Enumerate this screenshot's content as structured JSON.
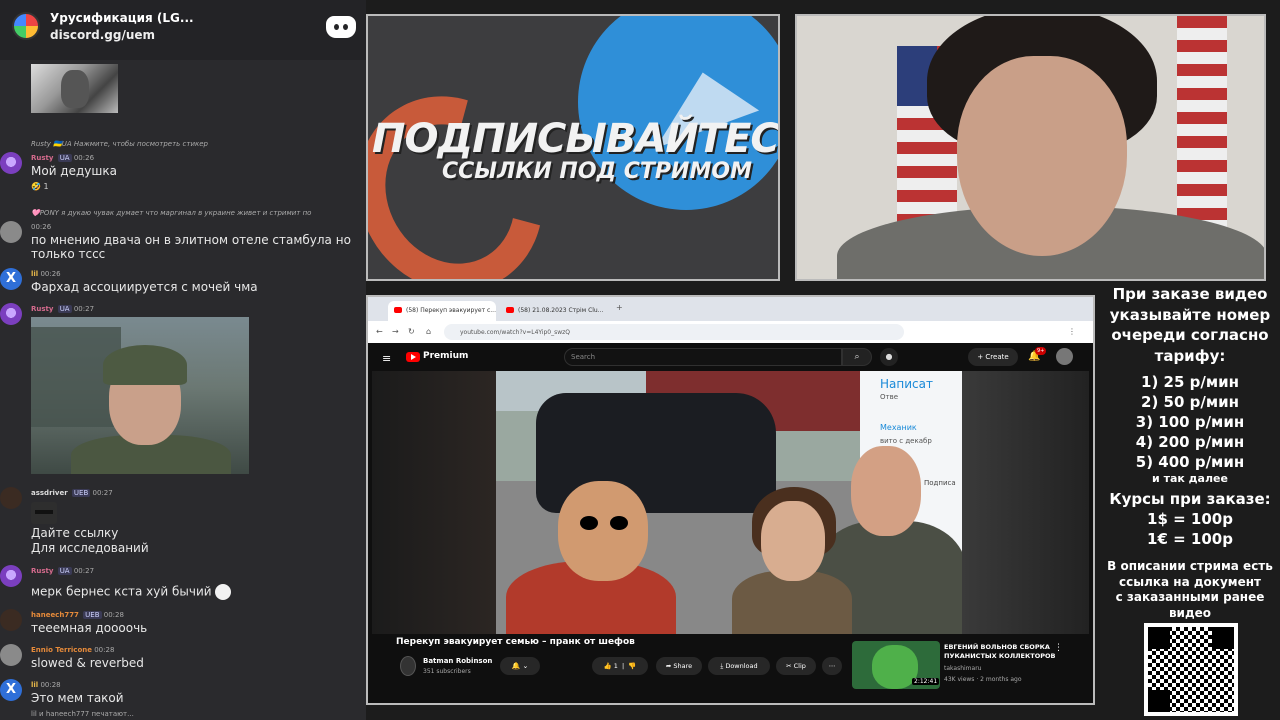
{
  "chat": {
    "server_name": "Урусификация (LG...",
    "invite": "discord.gg/uem",
    "messages": {
      "m1": {
        "reply": "Rusty 🇺🇦UA  Нажмите, чтобы посмотреть стикер",
        "user": "Rusty",
        "tag": "UA",
        "time": "00:26",
        "text": "Мой дедушка",
        "reaction": "🤣 1"
      },
      "m2": {
        "reply": "🩷PONY  я дукаю чувак думает что маргинал в украине живет и стримит по",
        "time": "00:26",
        "text1": "по мнению двача он в элитном отеле стамбула но",
        "text2": "только тссс"
      },
      "m3": {
        "user": "lil",
        "time": "00:26",
        "text": "Фархад ассоциируется с мочей чма"
      },
      "m4": {
        "user": "Rusty",
        "tag": "UA",
        "time": "00:27"
      },
      "m5": {
        "user": "assdriver",
        "tag": "UEB",
        "time": "00:27",
        "text1": "Дайте ссылку",
        "text2": "Для исследований"
      },
      "m6": {
        "user": "Rusty",
        "tag": "UA",
        "time": "00:27",
        "text": "мерк бернес кста хуй бычий"
      },
      "m7": {
        "user": "haneech777",
        "tag": "UEB",
        "time": "00:28",
        "text": "тееемная доооочь"
      },
      "m8": {
        "user": "Ennio Terricone",
        "time": "00:28",
        "text": "slowed & reverbed"
      },
      "m9": {
        "user": "lil",
        "time": "00:28",
        "text": "Это мем такой"
      }
    },
    "typing": "lil и haneech777 печатают..."
  },
  "banner": {
    "title": "ПОДПИСЫВАЙТЕСЬ",
    "subtitle": "ССЫЛКИ ПОД СТРИМОМ"
  },
  "browser": {
    "tabs": [
      "(58) Перекуп эвакуирует с...",
      "(58) 21.08.2023 Стрім Сlu..."
    ],
    "url": "youtube.com/watch?v=L4Yip0_swzQ",
    "youtube": {
      "brand": "Premium",
      "search_placeholder": "Search",
      "create_label": "Create",
      "notif_count": "9+",
      "video_title": "Перекуп эвакуирует семью – пранк от шефов",
      "channel_name": "Batman Robinson",
      "subscribers": "351 subscribers",
      "likes": "1",
      "share_label": "Share",
      "download_label": "Download",
      "clip_label": "Clip",
      "thumb_text": {
        "write": "Написат",
        "reply": "Отве",
        "mechanic": "Механик",
        "avito": "вито с декабр",
        "subscribe": "Подписа"
      },
      "rec": {
        "title": "ЕВГЕНИЙ ВОЛЬНОВ СБОРКА ПУКАНИСТЫХ КОЛЛЕКТОРОВ",
        "channel": "takashimaru",
        "meta": "43K views · 2 months ago",
        "duration": "2:12:41"
      }
    }
  },
  "info": {
    "intro": [
      "При заказе видео",
      "указывайте номер",
      "очереди согласно",
      "тарифу:"
    ],
    "tariffs": [
      "1) 25 р/мин",
      "2) 50 р/мин",
      "3) 100 р/мин",
      "4) 200 р/мин",
      "5) 400 р/мин"
    ],
    "etc": "и так далее",
    "courses_title": "Курсы при заказе:",
    "courses": [
      "1$ = 100р",
      "1€ = 100р"
    ],
    "desc": [
      "В описании стрима есть",
      "ссылка на документ",
      "с заказанными ранее",
      "видео"
    ]
  },
  "colors": {
    "discord_bg": "#2a2a2d",
    "youtube_red": "#ff0000",
    "telegram_blue": "#2f8fd8",
    "patreon_orange": "#c85a3a"
  }
}
